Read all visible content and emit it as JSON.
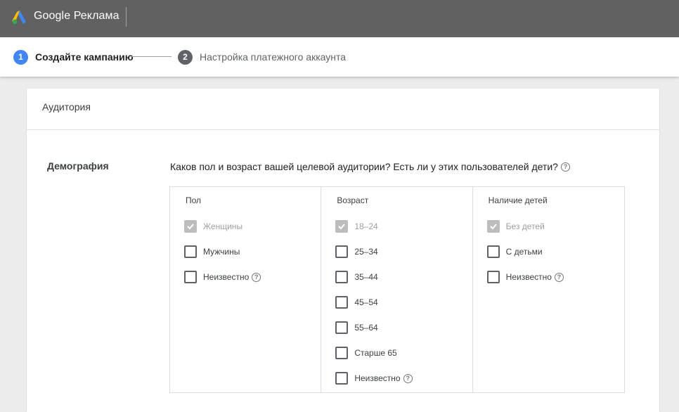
{
  "header": {
    "product": "Google Реклама"
  },
  "steps": [
    {
      "number": "1",
      "label": "Создайте кампанию"
    },
    {
      "number": "2",
      "label": "Настройка платежного аккаунта"
    }
  ],
  "card": {
    "title": "Аудитория",
    "section_label": "Демография",
    "question": "Каков пол и возраст вашей целевой аудитории? Есть ли у этих пользователей дети?",
    "columns": [
      {
        "title": "Пол",
        "options": [
          {
            "label": "Женщины",
            "checked": true,
            "disabled": true
          },
          {
            "label": "Мужчины",
            "checked": false
          },
          {
            "label": "Неизвестно",
            "checked": false,
            "help": true
          }
        ]
      },
      {
        "title": "Возраст",
        "options": [
          {
            "label": "18–24",
            "checked": true,
            "disabled": true
          },
          {
            "label": "25–34",
            "checked": false
          },
          {
            "label": "35–44",
            "checked": false
          },
          {
            "label": "45–54",
            "checked": false
          },
          {
            "label": "55–64",
            "checked": false
          },
          {
            "label": "Старше 65",
            "checked": false
          },
          {
            "label": "Неизвестно",
            "checked": false,
            "help": true
          }
        ]
      },
      {
        "title": "Наличие детей",
        "options": [
          {
            "label": "Без детей",
            "checked": true,
            "disabled": true
          },
          {
            "label": "С детьми",
            "checked": false
          },
          {
            "label": "Неизвестно",
            "checked": false,
            "help": true
          }
        ]
      }
    ]
  },
  "colors": {
    "topbar": "#616161",
    "step_active": "#4285f4",
    "step_inactive": "#5f6368"
  }
}
